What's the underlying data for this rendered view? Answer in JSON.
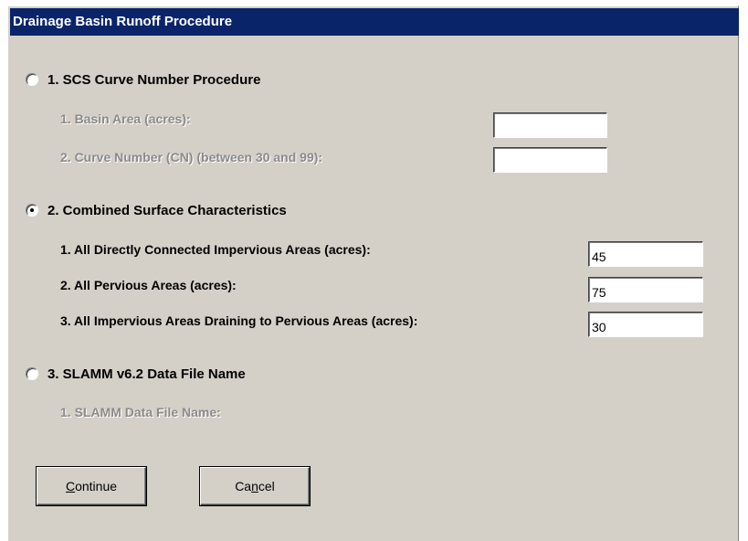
{
  "window": {
    "title": "Drainage Basin Runoff Procedure"
  },
  "option1": {
    "label": "1.  SCS Curve Number Procedure",
    "selected": false,
    "fields": [
      {
        "label": "1.  Basin Area (acres):",
        "value": ""
      },
      {
        "label": "2.  Curve Number (CN) (between 30 and 99):",
        "value": ""
      }
    ]
  },
  "option2": {
    "label": "2.  Combined Surface Characteristics",
    "selected": true,
    "fields": [
      {
        "label": "1.  All Directly Connected Impervious Areas (acres):",
        "value": "45"
      },
      {
        "label": "2.  All Pervious Areas (acres):",
        "value": "75"
      },
      {
        "label": "3.  All Impervious Areas Draining to Pervious Areas (acres):",
        "value": "30"
      }
    ]
  },
  "option3": {
    "label": "3.  SLAMM v6.2 Data File Name",
    "selected": false,
    "fields": [
      {
        "label": "1.  SLAMM Data File Name:"
      }
    ]
  },
  "buttons": {
    "continue": {
      "mnemonic": "C",
      "rest": "ontinue"
    },
    "cancel": {
      "pre": "Ca",
      "mnemonic": "n",
      "rest": "cel"
    }
  }
}
